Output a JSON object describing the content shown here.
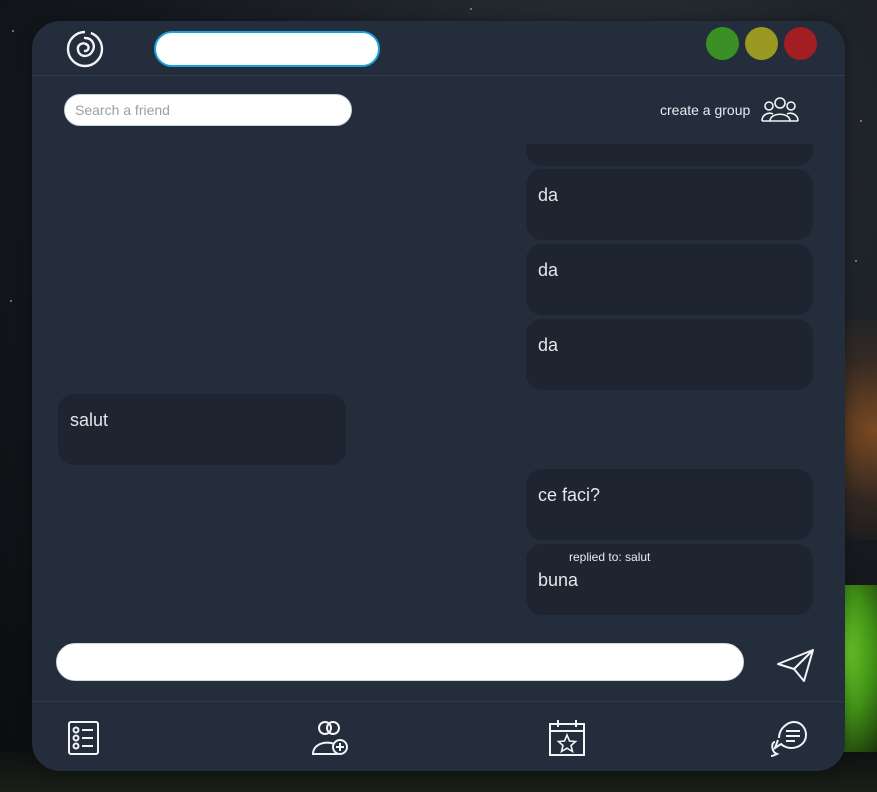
{
  "header": {
    "title_value": "",
    "window_buttons": [
      {
        "name": "maximize",
        "color": "#3a8f25"
      },
      {
        "name": "minimize",
        "color": "#9a9a22"
      },
      {
        "name": "close",
        "color": "#a21e22"
      }
    ],
    "accent_color": "#1aa3d9"
  },
  "toolbar": {
    "search_placeholder": "Search a friend",
    "create_group_label": "create a group",
    "create_group_icon": "group-icon"
  },
  "messages": [
    {
      "side": "right",
      "text": "",
      "partial": true
    },
    {
      "side": "right",
      "text": "da"
    },
    {
      "side": "right",
      "text": "da"
    },
    {
      "side": "right",
      "text": "da"
    },
    {
      "side": "left",
      "text": "salut"
    },
    {
      "side": "right",
      "text": "ce faci?"
    },
    {
      "side": "right",
      "text": "buna",
      "reply_to": "replied to: salut"
    }
  ],
  "composer": {
    "value": "",
    "send_icon": "send-icon"
  },
  "bottom_nav": [
    {
      "name": "list-icon"
    },
    {
      "name": "add-friend-icon"
    },
    {
      "name": "calendar-star-icon"
    },
    {
      "name": "chat-icon"
    }
  ]
}
